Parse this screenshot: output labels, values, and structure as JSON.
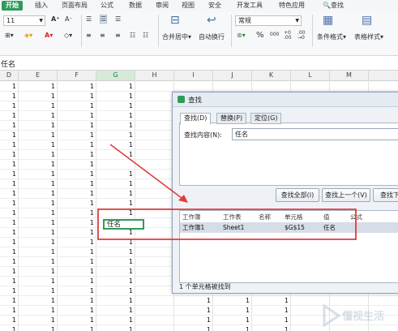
{
  "ribbon": {
    "tabs": [
      "开始",
      "插入",
      "页面布局",
      "公式",
      "数据",
      "审阅",
      "视图",
      "安全",
      "开发工具",
      "特色应用"
    ],
    "search_label": "查找",
    "font_size": "11",
    "merge_label": "合并居中",
    "autowrap_label": "自动换行",
    "number_format": "常规",
    "percent_symbol": "%",
    "thousands": "000",
    "cond_format_label": "条件格式",
    "table_style_label": "表格样式",
    "accent": "#2f9b5a"
  },
  "formula_bar": {
    "content": "任名"
  },
  "grid": {
    "columns": [
      "D",
      "E",
      "F",
      "G",
      "H",
      "I",
      "J",
      "K",
      "L",
      "M"
    ],
    "selected_column": "G",
    "cell_value": "1",
    "active_cell_text": "任名"
  },
  "dialog": {
    "title": "查找",
    "tabs": [
      "查找(D)",
      "替换(P)",
      "定位(G)"
    ],
    "find_label": "查找内容(N):",
    "find_value": "任名",
    "buttons": [
      "查找全部(I)",
      "查找上一个(V)",
      "查找下"
    ],
    "result_headers": [
      "工作簿",
      "工作表",
      "名称",
      "单元格",
      "值",
      "公式"
    ],
    "result_row": [
      "工作簿1",
      "Sheet1",
      "",
      "$G$15",
      "任名",
      ""
    ],
    "status": "1 个单元格被找到"
  },
  "watermark": {
    "text": "懂视生活"
  }
}
